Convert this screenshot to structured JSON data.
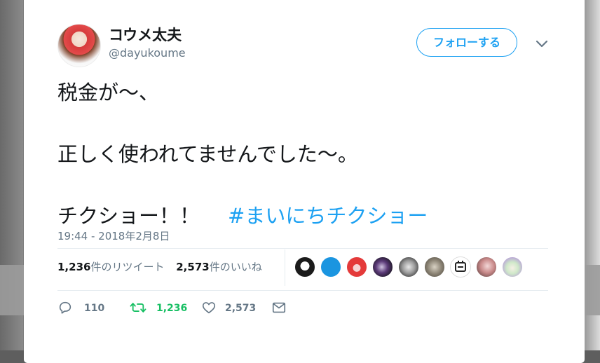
{
  "user": {
    "display_name": "コウメ太夫",
    "handle": "@dayukoume",
    "avatar_icon": "avatar"
  },
  "follow_button": {
    "label": "フォローする"
  },
  "menu_icon": "chevron-down-icon",
  "tweet": {
    "line1": "税金が〜、",
    "line2": "正しく使われてませんでした〜。",
    "line3": "チクショー！！",
    "hashtag": "#まいにちチクショー"
  },
  "timestamp": "19:44 - 2018年2月8日",
  "stats": {
    "retweets_count": "1,236",
    "retweets_label": "件のリツイート",
    "likes_count": "2,573",
    "likes_label": "件のいいね"
  },
  "actions": {
    "reply_count": "110",
    "retweet_count": "1,236",
    "like_count": "2,573"
  },
  "colors": {
    "accent": "#1da1f2",
    "retweet": "#17bf63",
    "muted": "#657786",
    "text": "#14171a"
  }
}
